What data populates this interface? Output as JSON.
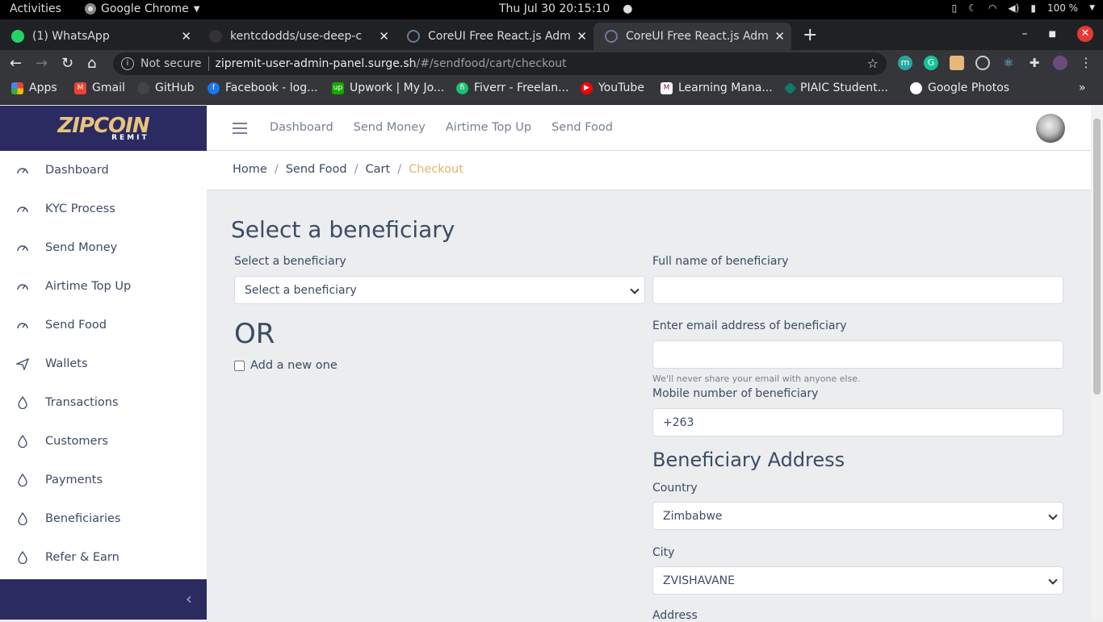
{
  "system_bar": {
    "activities": "Activities",
    "app_name": "Google Chrome",
    "clock": "Thu Jul 30  20:15:10",
    "battery": "100 %"
  },
  "browser": {
    "tabs": [
      {
        "title": "(1) WhatsApp",
        "color": "#25d366"
      },
      {
        "title": "kentcdodds/use-deep-c",
        "color": "#333333"
      },
      {
        "title": "CoreUI Free React.js Adm",
        "color": "#3c4b64"
      },
      {
        "title": "CoreUI Free React.js Adm",
        "color": "#3c4b64"
      }
    ],
    "new_tab": "+",
    "url_security": "Not secure",
    "url_host": "zipremit-user-admin-panel.surge.sh",
    "url_path": "/#/sendfood/cart/checkout",
    "bookmarks": [
      {
        "label": "Apps",
        "icon": "apps-grid-icon",
        "color": "#4285f4"
      },
      {
        "label": "Gmail",
        "icon": "gmail-icon",
        "color": "#ea4335"
      },
      {
        "label": "GitHub",
        "icon": "github-icon",
        "color": "#444444"
      },
      {
        "label": "Facebook - log...",
        "icon": "facebook-icon",
        "color": "#1877f2"
      },
      {
        "label": "Upwork | My Jo...",
        "icon": "upwork-icon",
        "color": "#14a800"
      },
      {
        "label": "Fiverr - Freelan...",
        "icon": "fiverr-icon",
        "color": "#1dbf73"
      },
      {
        "label": "YouTube",
        "icon": "youtube-icon",
        "color": "#ff0000"
      },
      {
        "label": "Learning Mana...",
        "icon": "lms-icon",
        "color": "#8b1538"
      },
      {
        "label": "PIAIC Student...",
        "icon": "piaic-icon",
        "color": "#0f7b6c"
      },
      {
        "label": "Google Photos",
        "icon": "globe-icon",
        "color": "#ffffff"
      }
    ]
  },
  "brand": {
    "logo_text": "ZIPCOIN",
    "logo_sub": "REMIT",
    "bg_color": "#2b2b62"
  },
  "sidebar": {
    "items": [
      {
        "label": "Dashboard",
        "icon": "speedometer-icon"
      },
      {
        "label": "KYC Process",
        "icon": "speedometer-icon"
      },
      {
        "label": "Send Money",
        "icon": "speedometer-icon"
      },
      {
        "label": "Airtime Top Up",
        "icon": "speedometer-icon"
      },
      {
        "label": "Send Food",
        "icon": "speedometer-icon"
      },
      {
        "label": "Wallets",
        "icon": "send-icon"
      },
      {
        "label": "Transactions",
        "icon": "drop-icon"
      },
      {
        "label": "Customers",
        "icon": "drop-icon"
      },
      {
        "label": "Payments",
        "icon": "drop-icon"
      },
      {
        "label": "Beneficiaries",
        "icon": "drop-icon"
      },
      {
        "label": "Refer & Earn",
        "icon": "drop-icon"
      }
    ]
  },
  "header": {
    "nav": [
      "Dashboard",
      "Send Money",
      "Airtime Top Up",
      "Send Food"
    ]
  },
  "breadcrumb": {
    "items": [
      "Home",
      "Send Food",
      "Cart"
    ],
    "current": "Checkout"
  },
  "form": {
    "title": "Select a beneficiary",
    "select_label": "Select a beneficiary",
    "select_value": "Select a beneficiary",
    "or_text": "OR",
    "add_new_label": "Add a new one",
    "full_name_label": "Full name of beneficiary",
    "full_name_value": "",
    "email_label": "Enter email address of beneficiary",
    "email_value": "",
    "email_help": "We'll never share your email with anyone else.",
    "mobile_label": "Mobile number of beneficiary",
    "mobile_value": "+263",
    "address_title": "Beneficiary Address",
    "country_label": "Country",
    "country_value": "Zimbabwe",
    "city_label": "City",
    "city_value": "ZVISHAVANE",
    "address_label": "Address"
  },
  "accent_color": "#e0b46b"
}
